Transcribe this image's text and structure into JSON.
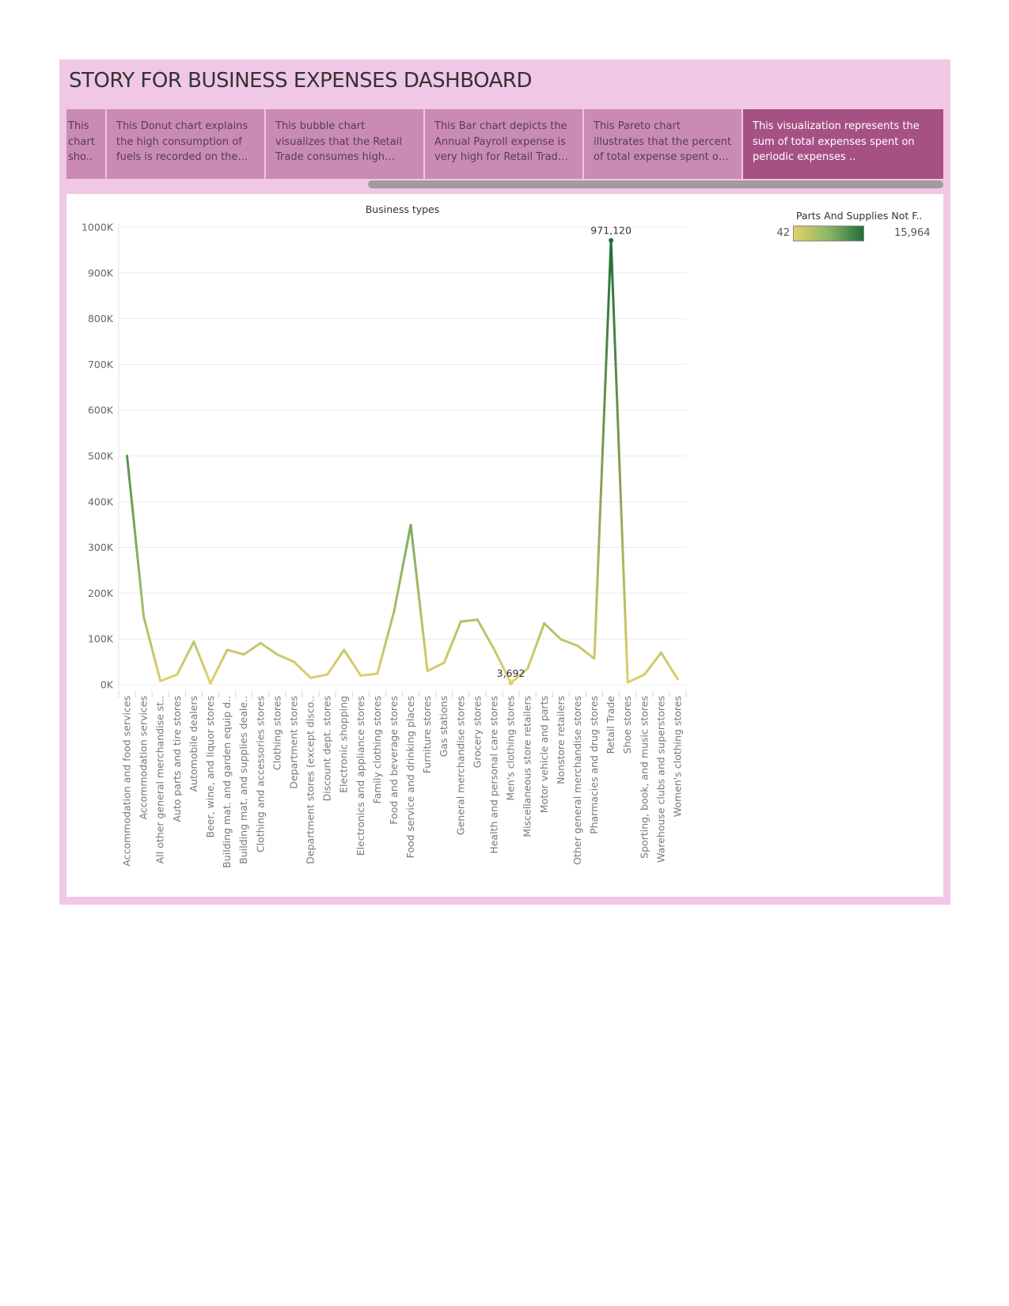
{
  "dashboard_title": "STORY FOR BUSINESS EXPENSES DASHBOARD",
  "story_points": [
    {
      "label": "This chart sho.."
    },
    {
      "label": "This Donut chart explains the high consumption of fuels is recorded on the Accomodati.."
    },
    {
      "label": "This bubble chart visualizes that the Retail Trade consumes high amount for A.."
    },
    {
      "label": "This Bar chart depicts the Annual Payroll expense is very high for Retail Trade as .."
    },
    {
      "label": "This Pareto chart illustrates that the percent of total expense spent on Taxes and .."
    },
    {
      "label": "This visualization represents the sum of total expenses spent on periodic expenses .."
    }
  ],
  "active_story_point": 5,
  "legend": {
    "title": "Parts And Supplies Not F..",
    "min_label": "42",
    "max_label": "15,964",
    "color_low": "#e3cf6a",
    "color_mid": "#8cb866",
    "color_high": "#1f6e3a"
  },
  "chart_data": {
    "type": "line",
    "title": "Business types",
    "xlabel": "",
    "ylabel": "",
    "ylim": [
      0,
      1000000
    ],
    "yticks": [
      0,
      100000,
      200000,
      300000,
      400000,
      500000,
      600000,
      700000,
      800000,
      900000,
      1000000
    ],
    "ytick_labels": [
      "0K",
      "100K",
      "200K",
      "300K",
      "400K",
      "500K",
      "600K",
      "700K",
      "800K",
      "900K",
      "1000K"
    ],
    "grid": true,
    "legend_position": "top-right",
    "categories": [
      "Accommodation and food services",
      "Accommodation services",
      "All other general merchandise st..",
      "Auto parts and tire stores",
      "Automobile dealers",
      "Beer, wine, and liquor stores",
      "Building mat. and garden equip d..",
      "Building mat. and supplies deale..",
      "Clothing and accessories stores",
      "Clothing stores",
      "Department stores",
      "Department stores (except disco..",
      "Discount dept. stores",
      "Electronic shopping",
      "Electronics and appliance stores",
      "Family clothing stores",
      "Food and beverage stores",
      "Food service and drinking places",
      "Furniture stores",
      "Gas stations",
      "General merchandise stores",
      "Grocery stores",
      "Health and personal care stores",
      "Men's clothing stores",
      "Miscellaneous store retailers",
      "Motor vehicle and parts",
      "Nonstore retailers",
      "Other general merchandise stores",
      "Pharmacies and drug stores",
      "Retail Trade",
      "Shoe stores",
      "Sporting, book, and music stores",
      "Warehouse clubs and superstores",
      "Women's clothing stores"
    ],
    "values": [
      500000,
      148000,
      8000,
      22000,
      94000,
      3000,
      76000,
      66000,
      91000,
      66000,
      50000,
      15000,
      22000,
      76000,
      20000,
      24000,
      160000,
      349000,
      30000,
      48000,
      138000,
      142000,
      77000,
      3692,
      35000,
      134000,
      99000,
      85000,
      57000,
      971120,
      5000,
      22000,
      70000,
      12000
    ],
    "color_values": [
      12000,
      5500,
      600,
      900,
      3200,
      150,
      2700,
      2400,
      3000,
      2200,
      1700,
      600,
      900,
      2600,
      800,
      1000,
      5800,
      9500,
      1100,
      1800,
      4600,
      4700,
      2600,
      42,
      1300,
      4500,
      3400,
      2900,
      2000,
      15964,
      200,
      900,
      2400,
      500
    ],
    "color_range": [
      42,
      15964
    ],
    "annotations": [
      {
        "category": "Retail Trade",
        "text": "971,120"
      },
      {
        "category": "Men's clothing stores",
        "text": "3,692"
      }
    ]
  }
}
